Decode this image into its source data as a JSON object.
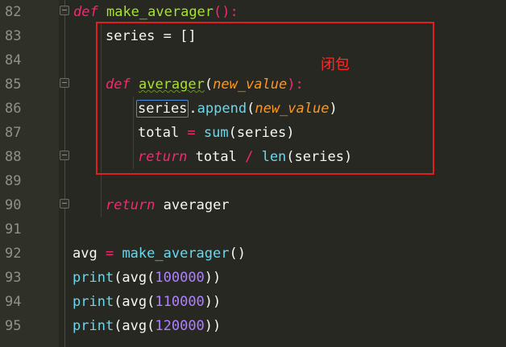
{
  "lines": [
    {
      "n": "82"
    },
    {
      "n": "83"
    },
    {
      "n": "84"
    },
    {
      "n": "85"
    },
    {
      "n": "86"
    },
    {
      "n": "87"
    },
    {
      "n": "88"
    },
    {
      "n": "89"
    },
    {
      "n": "90"
    },
    {
      "n": "91"
    },
    {
      "n": "92"
    },
    {
      "n": "93"
    },
    {
      "n": "94"
    },
    {
      "n": "95"
    }
  ],
  "code": {
    "l82": {
      "kw": "def",
      "fn": "make_averager",
      "punct": "():"
    },
    "l83": {
      "text": "series = []"
    },
    "l85": {
      "kw": "def",
      "fn": "averager",
      "open": "(",
      "param": "new_value",
      "close": "):"
    },
    "l86": {
      "var": "series",
      "dot": ".",
      "method": "append",
      "open": "(",
      "param": "new_value",
      "close": ")"
    },
    "l87": {
      "var": "total",
      "op": " = ",
      "builtin": "sum",
      "args": "(series)"
    },
    "l88": {
      "kw": "return",
      "a": " total ",
      "op": "/",
      "b": " ",
      "builtin": "len",
      "args": "(series)"
    },
    "l90": {
      "kw": "return",
      "rest": " averager"
    },
    "l92": {
      "var": "avg",
      "op": " = ",
      "fn": "make_averager",
      "rest": "()"
    },
    "l93": {
      "builtin": "print",
      "open": "(avg(",
      "num": "100000",
      "close": "))"
    },
    "l94": {
      "builtin": "print",
      "open": "(avg(",
      "num": "110000",
      "close": "))"
    },
    "l95": {
      "builtin": "print",
      "open": "(avg(",
      "num": "120000",
      "close": "))"
    }
  },
  "annotation": {
    "label": "闭包",
    "color": "#e02020"
  },
  "colors": {
    "background": "#272822",
    "keyword": "#f92672",
    "function": "#a6e22e",
    "builtin": "#66d9ef",
    "number": "#ae81ff",
    "param": "#fd971f"
  }
}
